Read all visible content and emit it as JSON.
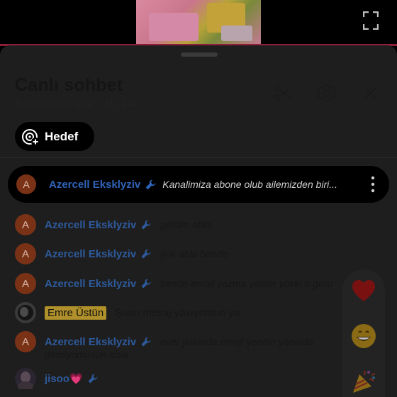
{
  "panel": {
    "title": "Canlı sohbet",
    "subtitle": "Başlıca mesajlar",
    "viewer_count": "140",
    "goal_label": "Hedef"
  },
  "pinned": {
    "author": "Azercell Eksklyziv",
    "avatar_letter": "A",
    "message": "Kanalimiza abone olub ailemizden biri..."
  },
  "messages": [
    {
      "author": "Azercell Eksklyziv",
      "avatar_letter": "A",
      "text": "geldim abla"
    },
    {
      "author": "Azercell Eksklyziv",
      "avatar_letter": "A",
      "text": "yok abla bende"
    },
    {
      "author": "Azercell Eksklyziv",
      "avatar_letter": "A",
      "text": "bende emoji yazma yeride yokki o goru"
    },
    {
      "author": "Emre Üstün",
      "text": "Şuan mesaj yazıyorsun ya"
    },
    {
      "author": "Azercell Eksklyziv",
      "avatar_letter": "A",
      "text": "evet yukarda emoji yerinin yaninda",
      "text_line2": "demiyomusun abla"
    },
    {
      "author": "jisoo💗"
    }
  ],
  "colors": {
    "accent_red": "#8e1e3a",
    "author_blue": "#2e5a9c",
    "avatar_orange": "#7a3217",
    "badge_gold": "#b0902a"
  },
  "icons": [
    "fullscreen-icon",
    "people-icon",
    "scissors-icon",
    "gear-icon",
    "close-icon",
    "goal-icon",
    "wrench-icon",
    "more-icon",
    "heart-icon",
    "smile-icon",
    "party-icon"
  ]
}
